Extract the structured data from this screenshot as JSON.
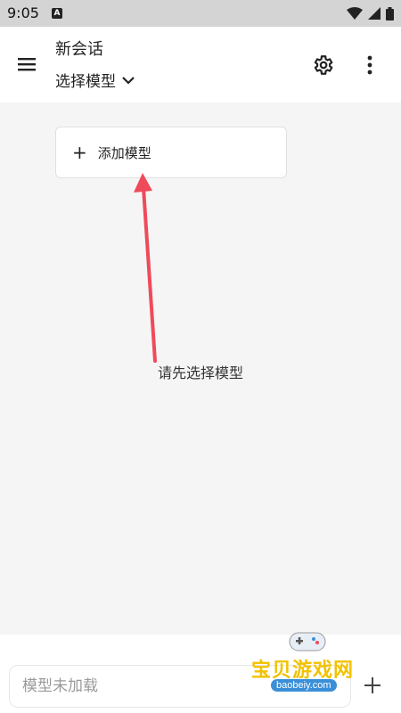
{
  "status_bar": {
    "time": "9:05",
    "notification_icon": "a-icon"
  },
  "header": {
    "title": "新会话",
    "model_selector": "选择模型",
    "icons": [
      "menu-icon",
      "settings-icon",
      "more-vert-icon"
    ]
  },
  "main": {
    "add_model_label": "添加模型",
    "empty_hint": "请先选择模型"
  },
  "composer": {
    "placeholder": "模型未加载"
  },
  "watermark": {
    "text": "宝贝游戏网",
    "url": "baobeiy.com"
  },
  "colors": {
    "arrow": "#ef4a5a",
    "background": "#f5f5f5",
    "watermark": "#f2c200"
  }
}
